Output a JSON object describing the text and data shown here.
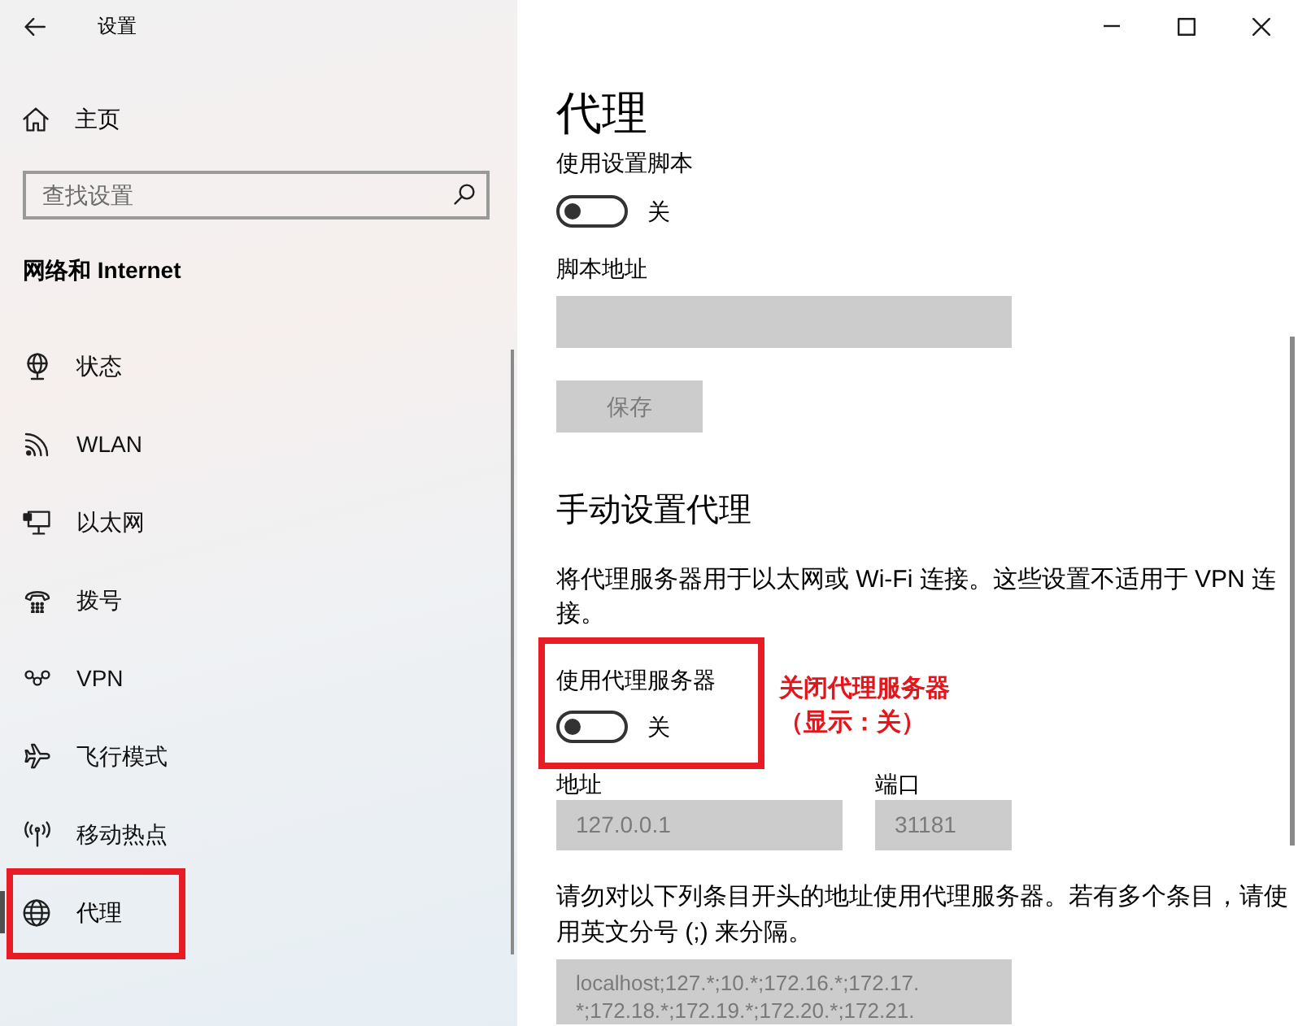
{
  "window": {
    "title": "设置"
  },
  "sidebar": {
    "home": "主页",
    "search": {
      "placeholder": "查找设置"
    },
    "section": "网络和 Internet",
    "items": [
      {
        "label": "状态",
        "selected": false,
        "highlighted": false
      },
      {
        "label": "WLAN",
        "selected": false,
        "highlighted": false
      },
      {
        "label": "以太网",
        "selected": false,
        "highlighted": false
      },
      {
        "label": "拨号",
        "selected": false,
        "highlighted": false
      },
      {
        "label": "VPN",
        "selected": false,
        "highlighted": false
      },
      {
        "label": "飞行模式",
        "selected": false,
        "highlighted": false
      },
      {
        "label": "移动热点",
        "selected": false,
        "highlighted": false
      },
      {
        "label": "代理",
        "selected": true,
        "highlighted": true
      }
    ]
  },
  "page": {
    "title": "代理",
    "script_toggle": {
      "label": "使用设置脚本",
      "on": false,
      "state_text": "关"
    },
    "script_address": {
      "label": "脚本地址",
      "disabled": true
    },
    "save_button": {
      "label": "保存",
      "disabled": true
    },
    "manual_heading": "手动设置代理",
    "manual_description": "将代理服务器用于以太网或 Wi-Fi 连接。这些设置不适用于 VPN 连接。",
    "proxy_toggle": {
      "label": "使用代理服务器",
      "on": false,
      "state_text": "关",
      "highlighted": true,
      "note": [
        "关闭代理服务器",
        "（显示：关）"
      ]
    },
    "address": {
      "label": "地址",
      "value": "127.0.0.1",
      "disabled": true
    },
    "port": {
      "label": "端口",
      "value": "31181",
      "disabled": true
    },
    "exceptions_description": "请勿对以下列条目开头的地址使用代理服务器。若有多个条目，请使用英文分号 (;) 来分隔。",
    "exceptions": {
      "value": "localhost;127.*;10.*;172.16.*;172.17.*;172.18.*;172.19.*;172.20.*;172.21.",
      "disabled": true
    }
  }
}
